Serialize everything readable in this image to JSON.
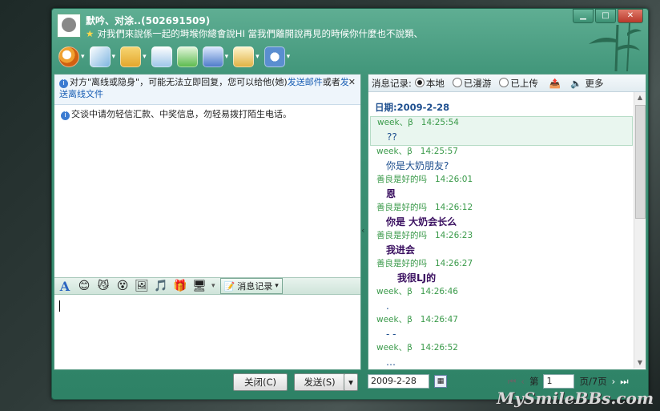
{
  "window": {
    "title": "默吟、对涂..(502691509)",
    "status": "对我們來說係一起的塒堠你總會說HI 當我們離開說再見的時候你什麼也不說類、"
  },
  "toolbar": {
    "icons": [
      "video-icon",
      "mic-icon",
      "folder-icon",
      "mail-icon",
      "add-icon",
      "user-card-icon",
      "game-icon",
      "settings-icon"
    ]
  },
  "chat": {
    "notice_pre": "对方\"离线或隐身\"，可能无法立即回复，您可以给他(她)",
    "notice_link1": "发送邮件",
    "notice_mid": "或者",
    "notice_link2": "发送离线文件",
    "warning": "交谈中请勿轻信汇款、中奖信息，勿轻易拨打陌生电话。",
    "msgrec_label": "消息记录",
    "close_btn": "关闭(C)",
    "send_btn": "发送(S)"
  },
  "history": {
    "label": "消息记录:",
    "options": [
      "本地",
      "已漫游",
      "已上传"
    ],
    "more": "更多",
    "date_header": "日期:2009-2-28",
    "entries": [
      {
        "sender": "week、β",
        "time": "14:25:54",
        "text": "??"
      },
      {
        "sender": "week、β",
        "time": "14:25:57",
        "text": "你是大奶朋友?"
      },
      {
        "sender": "善良是好的吗",
        "time": "14:26:01",
        "text": "恩"
      },
      {
        "sender": "善良是好的吗",
        "time": "14:26:12",
        "text": "你是  大奶会长么"
      },
      {
        "sender": "善良是好的吗",
        "time": "14:26:23",
        "text": "我进会"
      },
      {
        "sender": "善良是好的吗",
        "time": "14:26:27",
        "text": "我很LJ的"
      },
      {
        "sender": "week、β",
        "time": "14:26:46",
        "text": "."
      },
      {
        "sender": "week、β",
        "time": "14:26:47",
        "text": "- -"
      },
      {
        "sender": "week、β",
        "time": "14:26:52",
        "text": "…"
      }
    ],
    "date_input": "2009-2-28",
    "page_label": "第",
    "page_value": "1",
    "page_total": "页/7页"
  },
  "watermark": "MySmileBBs.com"
}
